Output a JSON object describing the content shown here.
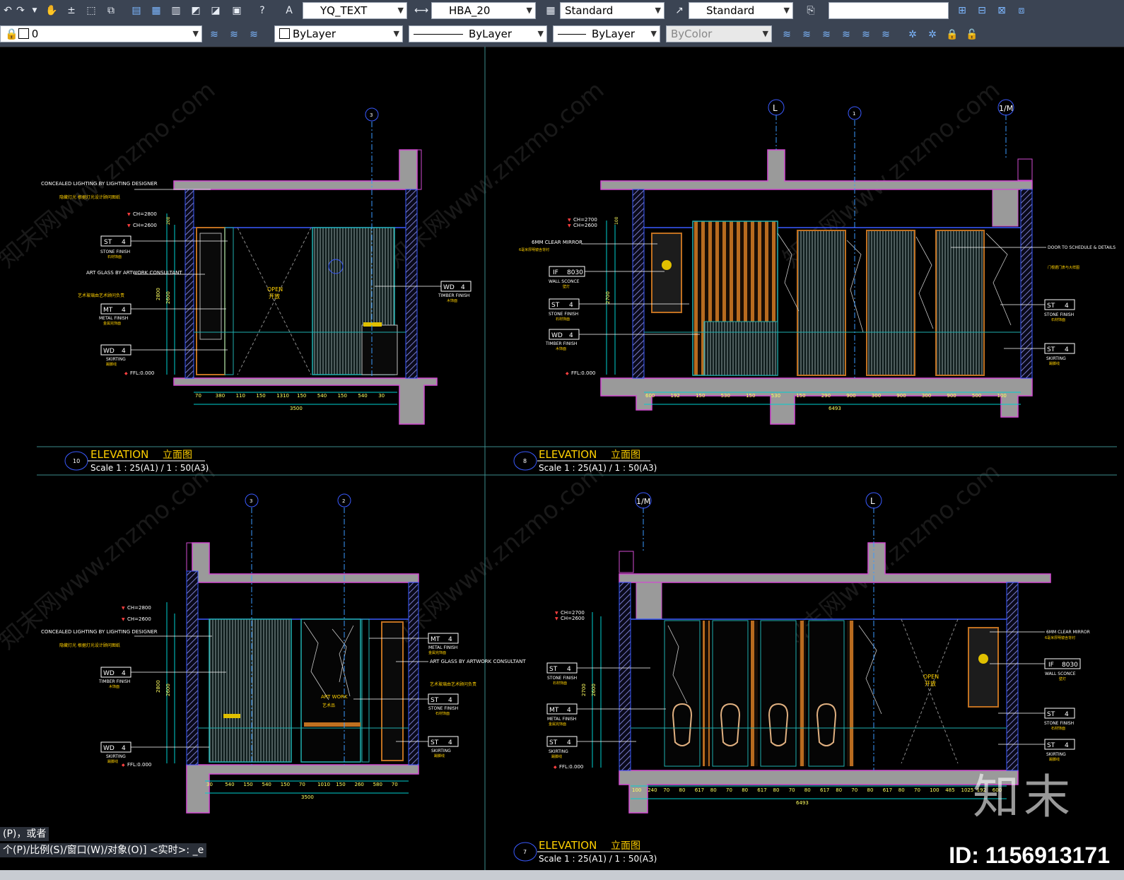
{
  "toolbar": {
    "text_style": "YQ_TEXT",
    "dim_style": "HBA_20",
    "table_style": "Standard",
    "multileader_style": "Standard",
    "search_value": ""
  },
  "layers": {
    "current_layer": "0",
    "color": "ByLayer",
    "linetype": "ByLayer",
    "lineweight": "ByLayer",
    "plot_style": "ByColor"
  },
  "drawing": {
    "elevations": [
      {
        "number": "10",
        "title": "ELEVATION",
        "title_cn": "立面图",
        "scale": "Scale 1 : 25(A1) / 1 : 50(A3)"
      },
      {
        "number": "8",
        "title": "ELEVATION",
        "title_cn": "立面图",
        "scale": "Scale 1 : 25(A1) / 1 : 50(A3)"
      },
      {
        "number": "7",
        "title": "ELEVATION",
        "title_cn": "立面图",
        "scale": "Scale 1 : 25(A1) / 1 : 50(A3)"
      }
    ],
    "grids": {
      "l": "L",
      "m": "1/M",
      "g1": "1",
      "g2": "2",
      "g3": "3"
    },
    "notes": {
      "concealed_lighting": "CONCEALED LIGHTING BY LIGHTING DESIGNER",
      "concealed_lighting_cn": "隐藏灯光 根据灯光设计顾问图纸",
      "art_glass": "ART GLASS BY ARTWORK CONSULTANT",
      "art_glass_cn": "艺术玻璃由艺术顾问负责",
      "metal_finish": "METAL FINISH",
      "metal_finish_cn": "金属完饰面",
      "stone_finish": "STONE FINISH",
      "stone_finish_cn": "石材饰面",
      "timber_finish": "TIMBER FINISH",
      "timber_finish_cn": "木饰面",
      "skirting": "SKIRTING",
      "skirting_cn": "踢脚线",
      "clear_mirror": "6MM CLEAR MIRROR",
      "clear_mirror_cn": "6毫米厚明镜含背衬",
      "wall_sconce": "WALL SCONCE",
      "wall_sconce_cn": "壁灯",
      "door_note": "DOOR TO SCHEDULE & DETAILS",
      "door_note_cn": "门根据门表与大样图",
      "open": "OPEN",
      "open_cn": "开放",
      "artwork": "ART WORK",
      "artwork_cn": "艺术品",
      "ch2800": "CH=2800",
      "ch2600": "CH=2600",
      "ch2700": "CH=2700",
      "ffl": "FFL:0.000"
    },
    "tags": {
      "st": "ST",
      "mt": "MT",
      "wd": "WD",
      "if": "IF",
      "n4": "4",
      "n8030": "8030"
    },
    "dims": {
      "e10": [
        "70",
        "380",
        "110",
        "150",
        "1310",
        "150",
        "540",
        "150",
        "540",
        "30"
      ],
      "e10_total": "3500",
      "e8": [
        "600",
        "192",
        "150",
        "530",
        "150",
        "530",
        "150",
        "290",
        "900",
        "300",
        "900",
        "300",
        "900",
        "500",
        "100"
      ],
      "e8_total": "6493",
      "e9": [
        "30",
        "540",
        "150",
        "540",
        "150",
        "70",
        "1010",
        "150",
        "260",
        "580",
        "70"
      ],
      "e9_total": "3500",
      "e7": [
        "100",
        "240",
        "70",
        "80",
        "617",
        "80",
        "70",
        "80",
        "617",
        "80",
        "70",
        "80",
        "617",
        "80",
        "70",
        "80",
        "617",
        "80",
        "70",
        "100",
        "485",
        "1025",
        "192",
        "600"
      ],
      "e7_total": "6493",
      "v2800": "2800",
      "v2600": "2600",
      "v2700": "2700",
      "v200": "200",
      "v100": "100"
    }
  },
  "command": {
    "history": "(P)，或者",
    "prompt": "个(P)/比例(S)/窗口(W)/对象(O)] <实时>: _e"
  },
  "watermark": {
    "site": "知末网www.znzmo.com",
    "logo": "知末",
    "id": "ID: 1156913171"
  }
}
